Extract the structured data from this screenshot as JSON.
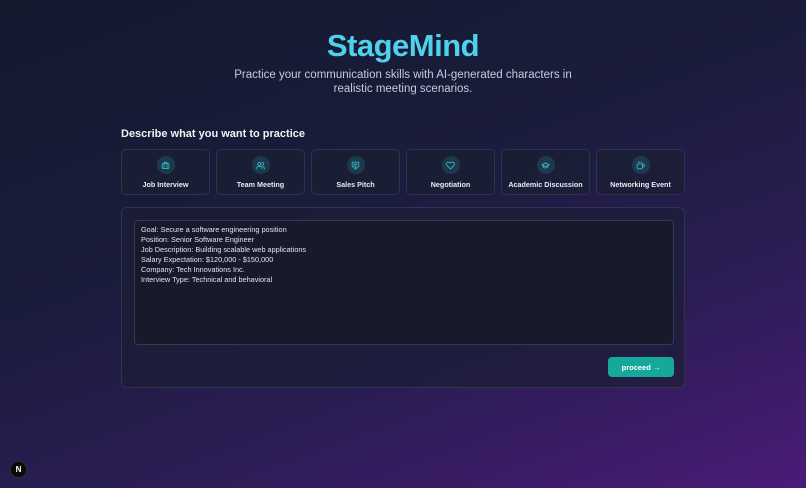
{
  "app": {
    "title": "StageMind",
    "subtitle": "Practice your communication skills with AI-generated characters in realistic meeting scenarios."
  },
  "section": {
    "title": "Describe what you want to practice"
  },
  "scenarios": [
    {
      "label": "Job Interview",
      "icon": "briefcase-icon"
    },
    {
      "label": "Team Meeting",
      "icon": "users-icon"
    },
    {
      "label": "Sales Pitch",
      "icon": "presentation-icon"
    },
    {
      "label": "Negotiation",
      "icon": "heart-icon"
    },
    {
      "label": "Academic Discussion",
      "icon": "graduation-cap-icon"
    },
    {
      "label": "Networking Event",
      "icon": "coffee-icon"
    }
  ],
  "description": {
    "lines": [
      "Goal: Secure a software engineering position",
      "Position: Senior Software Engineer",
      "Job Description: Building scalable web applications",
      "Salary Expectation: $120,000 - $150,000",
      "Company: Tech Innovations Inc.",
      "Interview Type: Technical and behavioral"
    ]
  },
  "actions": {
    "proceed_label": "proceed →"
  },
  "badge": {
    "label": "N"
  },
  "colors": {
    "accent": "#4fd1ec",
    "button": "#16a89a",
    "icon_stroke": "#3ec8d8"
  }
}
